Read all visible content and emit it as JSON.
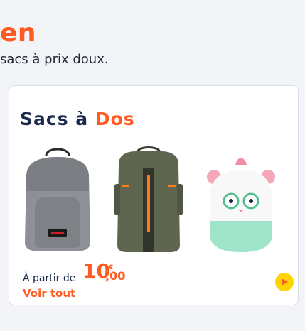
{
  "header": {
    "heading_fragment": "en",
    "subtitle": "sacs à prix doux."
  },
  "card": {
    "title_part1": "Sacs à",
    "title_part2": "Dos",
    "products": [
      {
        "name": "grey-eastpak-backpack"
      },
      {
        "name": "olive-travel-backpack"
      },
      {
        "name": "kids-animal-backpack"
      }
    ],
    "price": {
      "prefix": "À partir de",
      "amount": "10",
      "cents": ",00",
      "currency": "€"
    },
    "view_all_label": "Voir tout",
    "next_icon": "play-arrow-icon"
  },
  "colors": {
    "accent": "#ff5a1f",
    "navy": "#1b2a4a",
    "next_button": "#ffd500"
  }
}
